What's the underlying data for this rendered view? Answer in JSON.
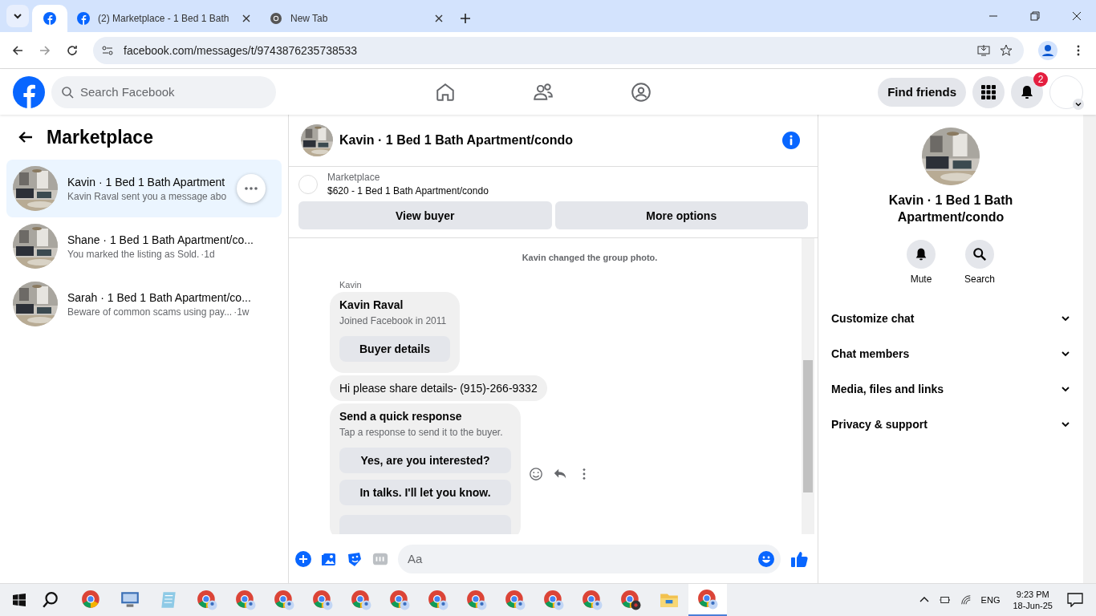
{
  "browser": {
    "tabs": [
      {
        "selected": true
      },
      {
        "title": "(2) Marketplace - 1 Bed 1 Bath",
        "selected": false
      },
      {
        "title": "New Tab",
        "selected": false
      }
    ],
    "url": "facebook.com/messages/t/9743876235738533"
  },
  "header": {
    "search": {
      "placeholder": "Search Facebook"
    },
    "find_friends": "Find friends",
    "notifications_badge": "2"
  },
  "sidebar": {
    "title": "Marketplace",
    "items": [
      {
        "name": "Kavin · 1 Bed 1 Bath Apartment",
        "preview": "Kavin Raval sent you a message abo",
        "selected": true
      },
      {
        "name": "Shane · 1 Bed 1 Bath Apartment/co...",
        "preview": "You marked the listing as Sold.",
        "time": "·1d",
        "selected": false
      },
      {
        "name": "Sarah · 1 Bed 1 Bath Apartment/co...",
        "preview": "Beware of common scams using pay...",
        "time": "·1w",
        "selected": false
      }
    ]
  },
  "chat": {
    "title": "Kavin · 1 Bed 1 Bath Apartment/condo",
    "listing": {
      "label": "Marketplace",
      "text": "$620 - 1 Bed 1 Bath Apartment/condo",
      "buttons": [
        "View buyer",
        "More options"
      ]
    },
    "events": [
      "Kavin changed the group photo."
    ],
    "sender": "Kavin",
    "buyer_card": {
      "name": "Kavin Raval",
      "subtitle": "Joined Facebook in 2011",
      "button": "Buyer details"
    },
    "message": "Hi please share details- (915)-266-9332",
    "quick_response": {
      "title": "Send a quick response",
      "subtitle": "Tap a response to send it to the buyer.",
      "options": [
        "Yes, are you interested?",
        "In talks. I'll let you know."
      ]
    },
    "composer": {
      "placeholder": "Aa"
    }
  },
  "details": {
    "title": "Kavin · 1 Bed 1 Bath Apartment/condo",
    "actions": [
      {
        "label": "Mute",
        "kind": "bell"
      },
      {
        "label": "Search",
        "kind": "search"
      }
    ],
    "sections": [
      {
        "label": "Customize chat",
        "expanded": false
      },
      {
        "label": "Chat members",
        "expanded": false
      },
      {
        "label": "Media, files and links",
        "expanded": false
      },
      {
        "label": "Privacy & support",
        "expanded": false
      }
    ]
  },
  "taskbar": {
    "apps": [
      {
        "kind": "chrome",
        "selected": false
      },
      {
        "kind": "remote",
        "selected": false
      },
      {
        "kind": "notepad",
        "selected": false
      },
      {
        "kind": "profile",
        "selected": false
      },
      {
        "kind": "profile",
        "selected": false
      },
      {
        "kind": "profile",
        "selected": false
      },
      {
        "kind": "profile",
        "selected": false
      },
      {
        "kind": "profile",
        "selected": false
      },
      {
        "kind": "profile",
        "selected": false
      },
      {
        "kind": "profile",
        "selected": false
      },
      {
        "kind": "profile",
        "selected": false
      },
      {
        "kind": "profile",
        "selected": false
      },
      {
        "kind": "profile",
        "selected": false
      },
      {
        "kind": "profile",
        "selected": false
      },
      {
        "kind": "media",
        "selected": false
      },
      {
        "kind": "folder",
        "selected": false
      },
      {
        "kind": "profile",
        "selected": true
      }
    ],
    "language": "ENG",
    "time": "9:23 PM",
    "date": "18-Jun-25"
  }
}
